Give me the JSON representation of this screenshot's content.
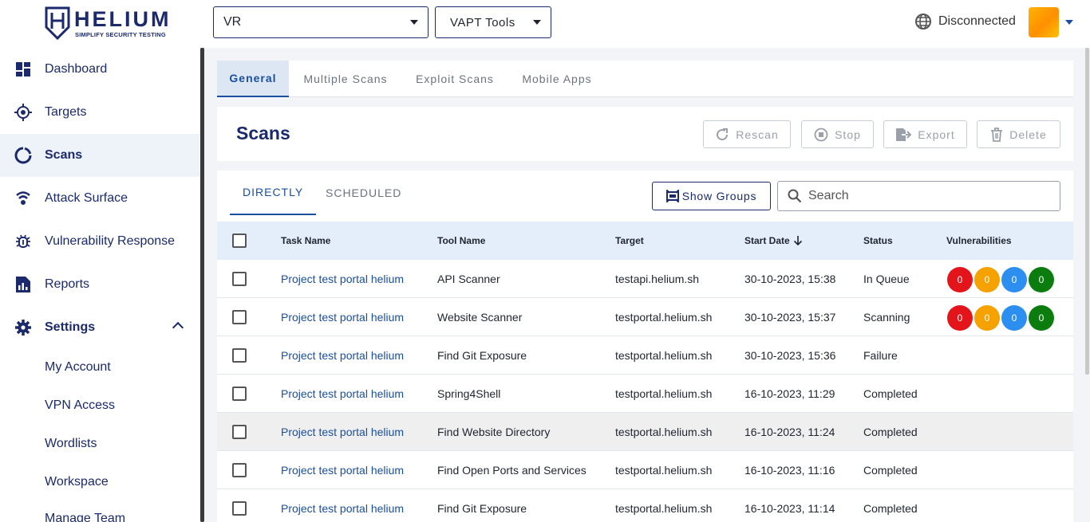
{
  "brand": {
    "name": "HELIUM",
    "tagline": "SIMPLIFY SECURITY TESTING"
  },
  "topbar": {
    "project_select": "VR",
    "tools_select": "VAPT Tools",
    "connection_status": "Disconnected"
  },
  "sidebar": {
    "items": [
      {
        "label": "Dashboard",
        "icon": "dashboard-icon"
      },
      {
        "label": "Targets",
        "icon": "target-icon"
      },
      {
        "label": "Scans",
        "icon": "scans-icon",
        "active": true
      },
      {
        "label": "Attack Surface",
        "icon": "attack-surface-icon"
      },
      {
        "label": "Vulnerability Response",
        "icon": "bug-icon"
      },
      {
        "label": "Reports",
        "icon": "reports-icon"
      },
      {
        "label": "Settings",
        "icon": "gear-icon",
        "expanded": true
      }
    ],
    "settings_sub": [
      "My Account",
      "VPN Access",
      "Wordlists",
      "Workspace",
      "Manage Team"
    ]
  },
  "tabs": [
    "General",
    "Multiple Scans",
    "Exploit Scans",
    "Mobile Apps"
  ],
  "scans": {
    "title": "Scans",
    "actions": {
      "rescan": "Rescan",
      "stop": "Stop",
      "export": "Export",
      "delete": "Delete"
    },
    "subtabs": [
      "DIRECTLY",
      "SCHEDULED"
    ],
    "show_groups": "Show Groups",
    "search_placeholder": "Search",
    "columns": [
      "Task Name",
      "Tool Name",
      "Target",
      "Start Date",
      "Status",
      "Vulnerabilities"
    ],
    "rows": [
      {
        "task": "Project test portal helium",
        "tool": "API Scanner",
        "target": "testapi.helium.sh",
        "date": "30-10-2023, 15:38",
        "status": "In Queue",
        "vulns": [
          "0",
          "0",
          "0",
          "0"
        ]
      },
      {
        "task": "Project test portal helium",
        "tool": "Website Scanner",
        "target": "testportal.helium.sh",
        "date": "30-10-2023, 15:37",
        "status": "Scanning",
        "vulns": [
          "0",
          "0",
          "0",
          "0"
        ]
      },
      {
        "task": "Project test portal helium",
        "tool": "Find Git Exposure",
        "target": "testportal.helium.sh",
        "date": "30-10-2023, 15:36",
        "status": "Failure",
        "vulns": []
      },
      {
        "task": "Project test portal helium",
        "tool": "Spring4Shell",
        "target": "testportal.helium.sh",
        "date": "16-10-2023, 11:29",
        "status": "Completed",
        "vulns": []
      },
      {
        "task": "Project test portal helium",
        "tool": "Find Website Directory",
        "target": "testportal.helium.sh",
        "date": "16-10-2023, 11:24",
        "status": "Completed",
        "vulns": []
      },
      {
        "task": "Project test portal helium",
        "tool": "Find Open Ports and Services",
        "target": "testportal.helium.sh",
        "date": "16-10-2023, 11:16",
        "status": "Completed",
        "vulns": []
      },
      {
        "task": "Project test portal helium",
        "tool": "Find Git Exposure",
        "target": "testportal.helium.sh",
        "date": "16-10-2023, 11:14",
        "status": "Completed",
        "vulns": []
      }
    ],
    "severity_colors": [
      "#e4141b",
      "#f5a100",
      "#2c8ff0",
      "#0b7d0f"
    ]
  }
}
